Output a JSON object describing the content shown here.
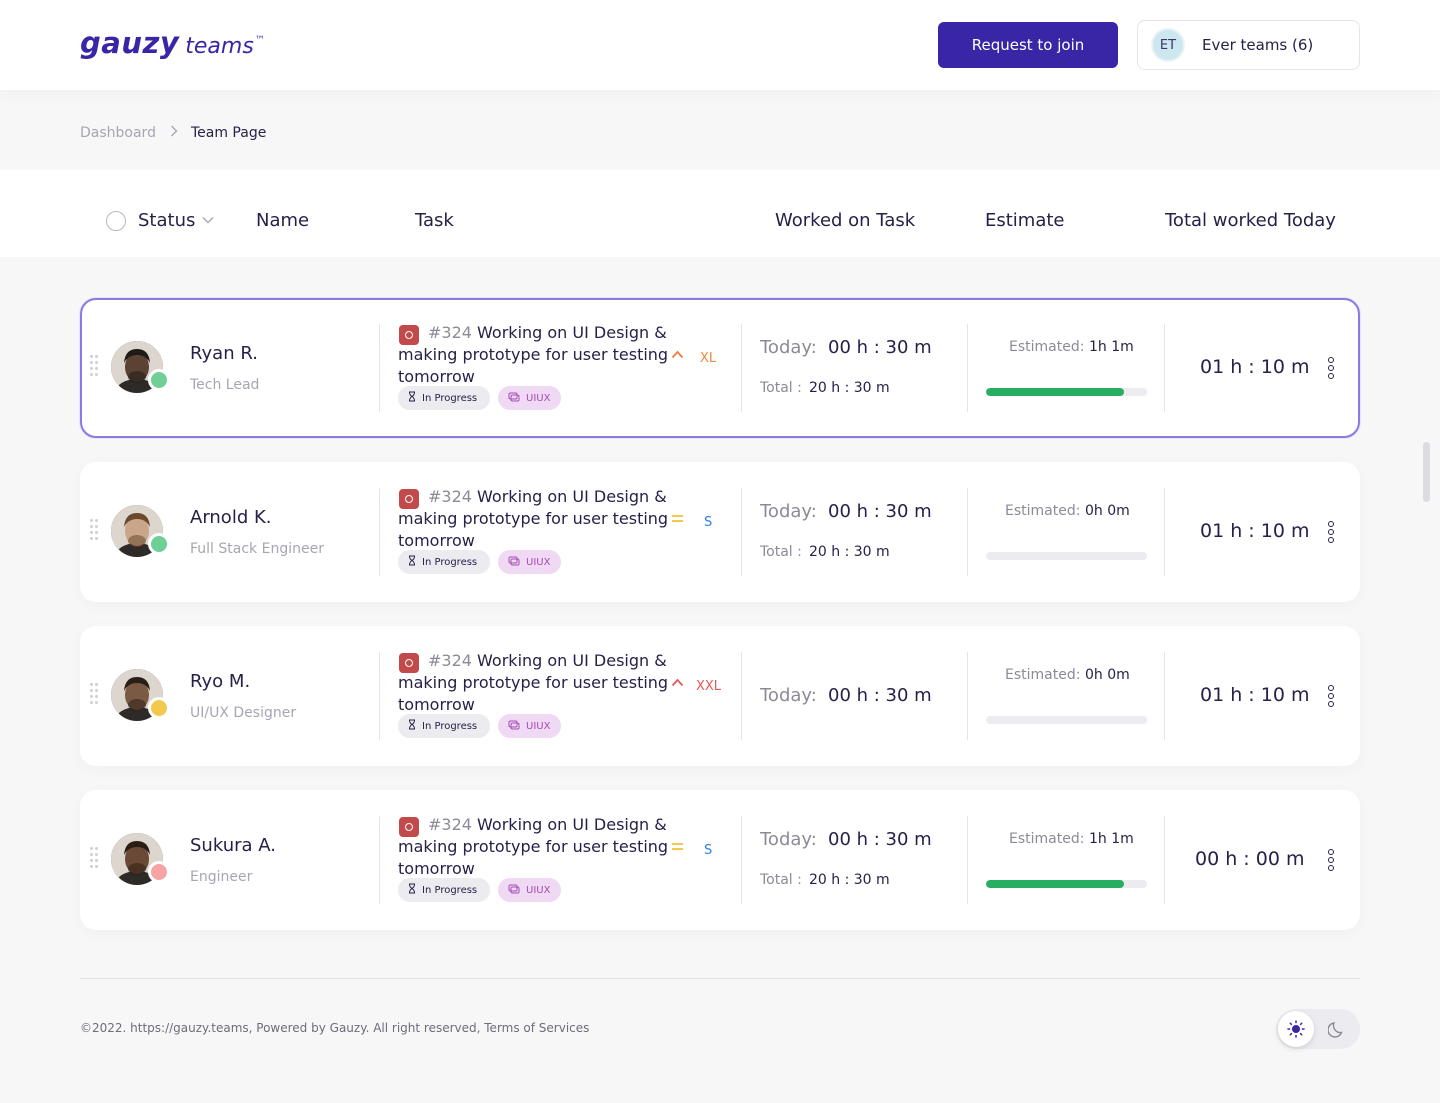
{
  "header": {
    "logo_main": "gauzy",
    "logo_sub": "teams",
    "logo_tm": "™",
    "join_label": "Request to join",
    "team_avatar": "ET",
    "team_name": "Ever teams (6)"
  },
  "breadcrumb": {
    "dashboard": "Dashboard",
    "separator_icon": "chevron-right-icon",
    "current": "Team Page"
  },
  "table_header": {
    "status": "Status",
    "name": "Name",
    "task": "Task",
    "worked": "Worked on Task",
    "estimate": "Estimate",
    "total": "Total worked Today"
  },
  "members": [
    {
      "name": "Ryan R.",
      "role": "Tech Lead",
      "status": "running",
      "status_color": "#6fcf97",
      "task_number": "#324",
      "task_title": "Working on UI Design & making prototype for user testing tomorrow",
      "priority_icon": "chevron-up-icon",
      "priority_color": "#f07b3f",
      "size": "XL",
      "size_color": "#f0883b",
      "status_chip": "In Progress",
      "label_chip": "UIUX",
      "today_label": "Today:",
      "today_value": "00 h : 30 m",
      "total_label": "Total :",
      "total_value": "20 h : 30 m",
      "estimated_label": "Estimated:",
      "estimated_value": "1h 1m",
      "progress": 0.86,
      "total_today": "01 h : 10 m",
      "active": true
    },
    {
      "name": "Arnold K.",
      "role": "Full Stack Engineer",
      "status": "online",
      "status_color": "#6fcf97",
      "task_number": "#324",
      "task_title": "Working on UI Design & making prototype for user testing tomorrow",
      "priority_icon": "equals-icon",
      "priority_color": "#f2c94c",
      "size": "S",
      "size_color": "#2f80ed",
      "status_chip": "In Progress",
      "label_chip": "UIUX",
      "today_label": "Today:",
      "today_value": "00 h : 30 m",
      "total_label": "Total :",
      "total_value": "20 h : 30 m",
      "estimated_label": "Estimated:",
      "estimated_value": "0h 0m",
      "progress": 0,
      "total_today": "01 h : 10 m",
      "active": false
    },
    {
      "name": "Ryo M.",
      "role": "UI/UX Designer",
      "status": "paused",
      "status_color": "#f2c94c",
      "task_number": "#324",
      "task_title": "Working on UI Design & making prototype for user testing tomorrow",
      "priority_icon": "chevron-up-icon",
      "priority_color": "#eb5757",
      "size": "XXL",
      "size_color": "#eb5757",
      "status_chip": "In Progress",
      "label_chip": "UIUX",
      "today_label": "Today:",
      "today_value": "00 h : 30 m",
      "total_label": "",
      "total_value": "",
      "estimated_label": "Estimated:",
      "estimated_value": "0h 0m",
      "progress": 0,
      "total_today": "01 h : 10 m",
      "active": false
    },
    {
      "name": "Sukura A.",
      "role": "Engineer",
      "status": "stopped",
      "status_color": "#f5a3a3",
      "task_number": "#324",
      "task_title": "Working on UI Design & making prototype for user testing tomorrow",
      "priority_icon": "equals-icon",
      "priority_color": "#f2c94c",
      "size": "S",
      "size_color": "#2f80ed",
      "status_chip": "In Progress",
      "label_chip": "UIUX",
      "today_label": "Today:",
      "today_value": "00 h : 30 m",
      "total_label": "Total :",
      "total_value": "20 h : 30 m",
      "estimated_label": "Estimated:",
      "estimated_value": "1h 1m",
      "progress": 0.86,
      "total_today": "00 h : 00 m",
      "active": false
    }
  ],
  "footer": {
    "text": "©2022. https://gauzy.teams, Powered by Gauzy. All right reserved, Terms of Services",
    "light_icon": "sun-icon",
    "dark_icon": "moon-icon"
  }
}
